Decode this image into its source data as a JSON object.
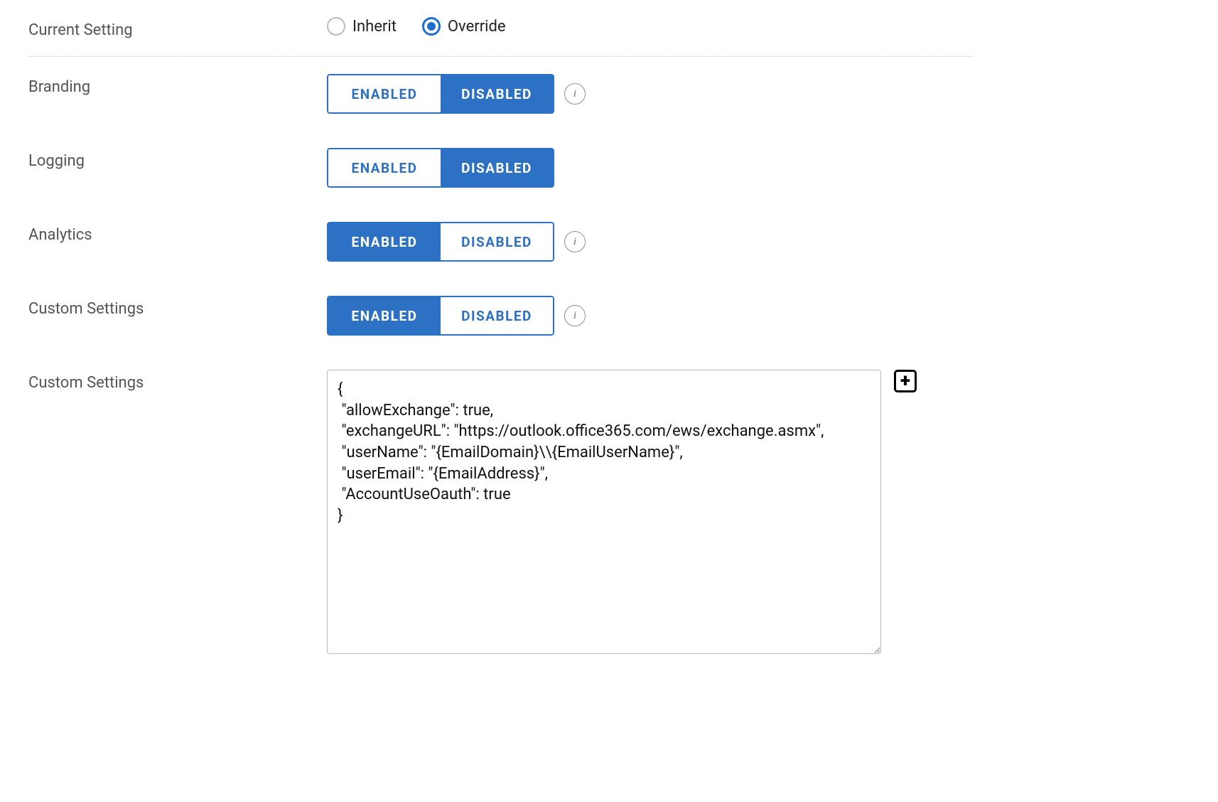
{
  "currentSetting": {
    "label": "Current Setting",
    "inherit": "Inherit",
    "override": "Override",
    "selected": "override"
  },
  "toggleLabels": {
    "enabled": "ENABLED",
    "disabled": "DISABLED"
  },
  "rows": {
    "branding": {
      "label": "Branding",
      "state": "disabled",
      "info": true
    },
    "logging": {
      "label": "Logging",
      "state": "disabled",
      "info": false
    },
    "analytics": {
      "label": "Analytics",
      "state": "enabled",
      "info": true
    },
    "customToggle": {
      "label": "Custom Settings",
      "state": "enabled",
      "info": true
    }
  },
  "customSettings": {
    "label": "Custom Settings",
    "value": "{\n \"allowExchange\": true,\n \"exchangeURL\": \"https://outlook.office365.com/ews/exchange.asmx\",\n \"userName\": \"{EmailDomain}\\\\{EmailUserName}\",\n \"userEmail\": \"{EmailAddress}\",\n \"AccountUseOauth\": true\n}"
  }
}
